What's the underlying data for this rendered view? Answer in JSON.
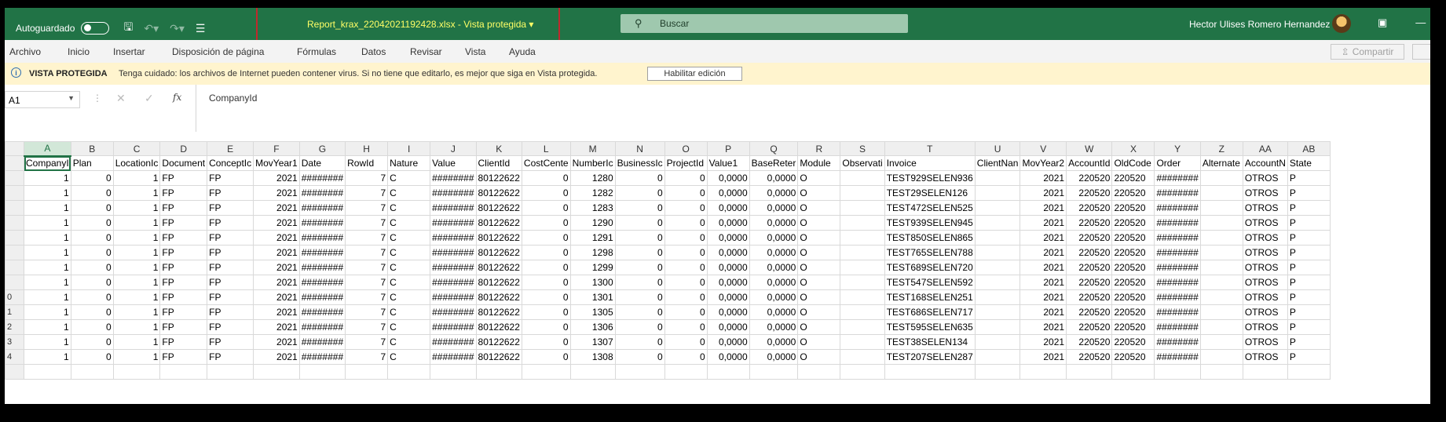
{
  "titlebar": {
    "autosave_label": "Autoguardado",
    "document_title": "Report_krax_22042021192428.xlsx  -  Vista protegida  ▾",
    "search_placeholder": "Buscar",
    "user_name": "Hector Ulises Romero Hernandez"
  },
  "ribbon": {
    "tabs": [
      "Archivo",
      "Inicio",
      "Insertar",
      "Disposición de página",
      "Fórmulas",
      "Datos",
      "Revisar",
      "Vista",
      "Ayuda"
    ],
    "share_label": "Compartir"
  },
  "protected_view": {
    "title": "VISTA PROTEGIDA",
    "message": "Tenga cuidado: los archivos de Internet pueden contener virus. Si no tiene que editarlo, es mejor que siga en Vista protegida.",
    "enable_button": "Habilitar edición"
  },
  "formula_bar": {
    "name_box": "A1",
    "value": "CompanyId"
  },
  "sheet": {
    "columns": [
      "A",
      "B",
      "C",
      "D",
      "E",
      "F",
      "G",
      "H",
      "I",
      "J",
      "K",
      "L",
      "M",
      "N",
      "O",
      "P",
      "Q",
      "R",
      "S",
      "T",
      "U",
      "V",
      "W",
      "X",
      "Y",
      "Z",
      "AA",
      "AB"
    ],
    "header_row": [
      "CompanyI",
      "Plan",
      "LocationIc",
      "Document",
      "ConceptIc",
      "MovYear1",
      "Date",
      "RowId",
      "Nature",
      "Value",
      "ClientId",
      "CostCente",
      "NumberIc",
      "BusinessIc",
      "ProjectId",
      "Value1",
      "BaseReter",
      "Module",
      "Observati",
      "Invoice",
      "ClientNan",
      "MovYear2",
      "AccountId",
      "OldCode",
      "Order",
      "Alternate",
      "AccountN",
      "State"
    ],
    "row_numbers": [
      "",
      "",
      "",
      "",
      "",
      "",
      "",
      "",
      "",
      "0",
      "1",
      "2",
      "3",
      "4"
    ],
    "rows": [
      [
        "1",
        "0",
        "1",
        "FP",
        "FP",
        "2021",
        "########",
        "7",
        "C",
        "########",
        "80122622",
        "0",
        "1280",
        "0",
        "0",
        "0,0000",
        "0,0000",
        "O",
        "",
        "TEST929SELEN936",
        "",
        "2021",
        "220520",
        "220520",
        "########",
        "",
        "OTROS",
        "P"
      ],
      [
        "1",
        "0",
        "1",
        "FP",
        "FP",
        "2021",
        "########",
        "7",
        "C",
        "########",
        "80122622",
        "0",
        "1282",
        "0",
        "0",
        "0,0000",
        "0,0000",
        "O",
        "",
        "TEST29SELEN126",
        "",
        "2021",
        "220520",
        "220520",
        "########",
        "",
        "OTROS",
        "P"
      ],
      [
        "1",
        "0",
        "1",
        "FP",
        "FP",
        "2021",
        "########",
        "7",
        "C",
        "########",
        "80122622",
        "0",
        "1283",
        "0",
        "0",
        "0,0000",
        "0,0000",
        "O",
        "",
        "TEST472SELEN525",
        "",
        "2021",
        "220520",
        "220520",
        "########",
        "",
        "OTROS",
        "P"
      ],
      [
        "1",
        "0",
        "1",
        "FP",
        "FP",
        "2021",
        "########",
        "7",
        "C",
        "########",
        "80122622",
        "0",
        "1290",
        "0",
        "0",
        "0,0000",
        "0,0000",
        "O",
        "",
        "TEST939SELEN945",
        "",
        "2021",
        "220520",
        "220520",
        "########",
        "",
        "OTROS",
        "P"
      ],
      [
        "1",
        "0",
        "1",
        "FP",
        "FP",
        "2021",
        "########",
        "7",
        "C",
        "########",
        "80122622",
        "0",
        "1291",
        "0",
        "0",
        "0,0000",
        "0,0000",
        "O",
        "",
        "TEST850SELEN865",
        "",
        "2021",
        "220520",
        "220520",
        "########",
        "",
        "OTROS",
        "P"
      ],
      [
        "1",
        "0",
        "1",
        "FP",
        "FP",
        "2021",
        "########",
        "7",
        "C",
        "########",
        "80122622",
        "0",
        "1298",
        "0",
        "0",
        "0,0000",
        "0,0000",
        "O",
        "",
        "TEST765SELEN788",
        "",
        "2021",
        "220520",
        "220520",
        "########",
        "",
        "OTROS",
        "P"
      ],
      [
        "1",
        "0",
        "1",
        "FP",
        "FP",
        "2021",
        "########",
        "7",
        "C",
        "########",
        "80122622",
        "0",
        "1299",
        "0",
        "0",
        "0,0000",
        "0,0000",
        "O",
        "",
        "TEST689SELEN720",
        "",
        "2021",
        "220520",
        "220520",
        "########",
        "",
        "OTROS",
        "P"
      ],
      [
        "1",
        "0",
        "1",
        "FP",
        "FP",
        "2021",
        "########",
        "7",
        "C",
        "########",
        "80122622",
        "0",
        "1300",
        "0",
        "0",
        "0,0000",
        "0,0000",
        "O",
        "",
        "TEST547SELEN592",
        "",
        "2021",
        "220520",
        "220520",
        "########",
        "",
        "OTROS",
        "P"
      ],
      [
        "1",
        "0",
        "1",
        "FP",
        "FP",
        "2021",
        "########",
        "7",
        "C",
        "########",
        "80122622",
        "0",
        "1301",
        "0",
        "0",
        "0,0000",
        "0,0000",
        "O",
        "",
        "TEST168SELEN251",
        "",
        "2021",
        "220520",
        "220520",
        "########",
        "",
        "OTROS",
        "P"
      ],
      [
        "1",
        "0",
        "1",
        "FP",
        "FP",
        "2021",
        "########",
        "7",
        "C",
        "########",
        "80122622",
        "0",
        "1305",
        "0",
        "0",
        "0,0000",
        "0,0000",
        "O",
        "",
        "TEST686SELEN717",
        "",
        "2021",
        "220520",
        "220520",
        "########",
        "",
        "OTROS",
        "P"
      ],
      [
        "1",
        "0",
        "1",
        "FP",
        "FP",
        "2021",
        "########",
        "7",
        "C",
        "########",
        "80122622",
        "0",
        "1306",
        "0",
        "0",
        "0,0000",
        "0,0000",
        "O",
        "",
        "TEST595SELEN635",
        "",
        "2021",
        "220520",
        "220520",
        "########",
        "",
        "OTROS",
        "P"
      ],
      [
        "1",
        "0",
        "1",
        "FP",
        "FP",
        "2021",
        "########",
        "7",
        "C",
        "########",
        "80122622",
        "0",
        "1307",
        "0",
        "0",
        "0,0000",
        "0,0000",
        "O",
        "",
        "TEST38SELEN134",
        "",
        "2021",
        "220520",
        "220520",
        "########",
        "",
        "OTROS",
        "P"
      ],
      [
        "1",
        "0",
        "1",
        "FP",
        "FP",
        "2021",
        "########",
        "7",
        "C",
        "########",
        "80122622",
        "0",
        "1308",
        "0",
        "0",
        "0,0000",
        "0,0000",
        "O",
        "",
        "TEST207SELEN287",
        "",
        "2021",
        "220520",
        "220520",
        "########",
        "",
        "OTROS",
        "P"
      ]
    ]
  },
  "colors": {
    "excel_green": "#217346",
    "protected_bar": "#fff4ce",
    "highlight_red": "#c0282d",
    "title_yellow": "#ffff66"
  }
}
